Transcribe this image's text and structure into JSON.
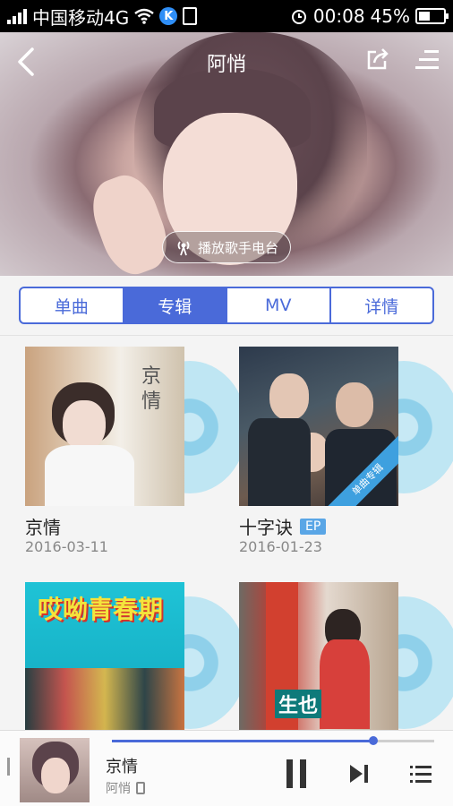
{
  "status_bar": {
    "carrier": "中国移动4G",
    "time": "00:08",
    "battery": "45%",
    "battery_level": 0.45
  },
  "header": {
    "title": "阿悄",
    "radio_label": "播放歌手电台"
  },
  "tabs": [
    {
      "label": "单曲",
      "active": false
    },
    {
      "label": "专辑",
      "active": true
    },
    {
      "label": "MV",
      "active": false
    },
    {
      "label": "详情",
      "active": false
    }
  ],
  "albums": [
    {
      "title": "京情",
      "date": "2016-03-11",
      "cover_text": "京情"
    },
    {
      "title": "十字诀",
      "date": "2016-01-23",
      "badge": "EP",
      "ribbon": "单曲专辑"
    },
    {
      "title": "",
      "date": "",
      "cover_text": "哎呦青春期"
    },
    {
      "title": "",
      "date": "",
      "cover_text": "生也"
    }
  ],
  "player": {
    "title": "京情",
    "artist": "阿悄",
    "progress": 0.81
  },
  "colors": {
    "accent": "#4a6ad9",
    "disc": "#8fd0ea"
  }
}
